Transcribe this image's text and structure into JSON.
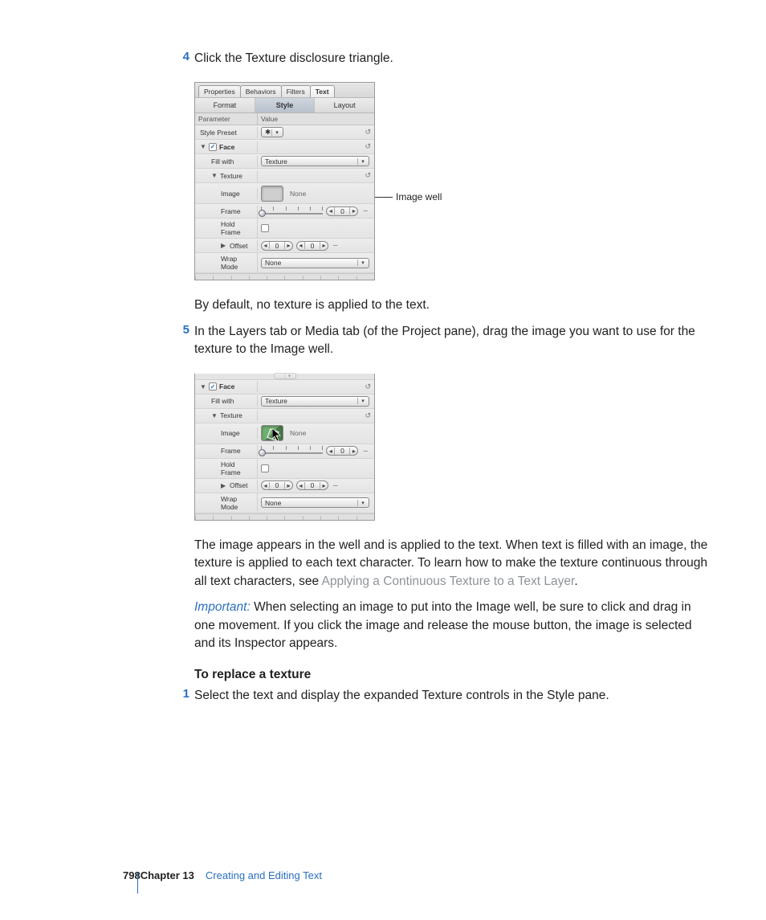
{
  "steps": {
    "s4": {
      "num": "4",
      "text": "Click the Texture disclosure triangle."
    },
    "s5": {
      "num": "5",
      "text": "In the Layers tab or Media tab (of the Project pane), drag the image you want to use for the texture to the Image well."
    },
    "s1b": {
      "num": "1",
      "text": "Select the text and display the expanded Texture controls in the Style pane."
    }
  },
  "body": {
    "after4": "By default, no texture is applied to the text.",
    "after5a": "The image appears in the well and is applied to the text. When text is filled with an image, the texture is applied to each text character. To learn how to make the texture continuous through all text characters, see ",
    "after5link": "Applying a Continuous Texture to a Text Layer",
    "after5end": ".",
    "important_label": "Important:  ",
    "important_text": "When selecting an image to put into the Image well, be sure to click and drag in one movement. If you click the image and release the mouse button, the image is selected and its Inspector appears.",
    "subhead": "To replace a texture"
  },
  "callout": {
    "image_well": "Image well"
  },
  "inspector": {
    "tabs": {
      "properties": "Properties",
      "behaviors": "Behaviors",
      "filters": "Filters",
      "text": "Text"
    },
    "subtabs": {
      "format": "Format",
      "style": "Style",
      "layout": "Layout"
    },
    "headers": {
      "parameter": "Parameter",
      "value": "Value"
    },
    "rows": {
      "style_preset": "Style Preset",
      "face": "Face",
      "fill_with": "Fill with",
      "fill_with_value": "Texture",
      "texture": "Texture",
      "image": "Image",
      "image_value": "None",
      "frame": "Frame",
      "frame_value": "0",
      "hold_frame": "Hold Frame",
      "offset": "Offset",
      "offset_x": "0",
      "offset_y": "0",
      "wrap_mode": "Wrap Mode",
      "wrap_mode_value": "None"
    }
  },
  "footer": {
    "page": "798",
    "chapter": "Chapter 13",
    "title": "Creating and Editing Text"
  }
}
